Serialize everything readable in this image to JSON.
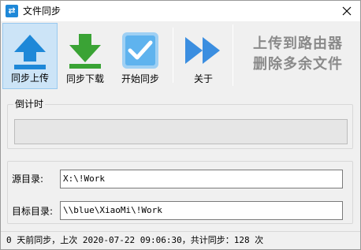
{
  "window": {
    "title": "文件同步"
  },
  "toolbar": {
    "buttons": [
      {
        "label": "同步上传"
      },
      {
        "label": "同步下载"
      },
      {
        "label": "开始同步"
      },
      {
        "label": "关于"
      }
    ],
    "hint_line1": "上传到路由器",
    "hint_line2": "删除多余文件"
  },
  "countdown": {
    "label": "倒计时",
    "progress": 0
  },
  "paths": {
    "source_label": "源目录:",
    "source_value": "X:\\!Work",
    "target_label": "目标目录:",
    "target_value": "\\\\blue\\XiaoMi\\!Work"
  },
  "status": {
    "text": "0 天前同步，上次 2020-07-22 09:06:30，共计同步：128 次"
  },
  "colors": {
    "accent_blue": "#1e88d8",
    "download_green": "#3aa335",
    "active_bg": "#cce4f7"
  }
}
